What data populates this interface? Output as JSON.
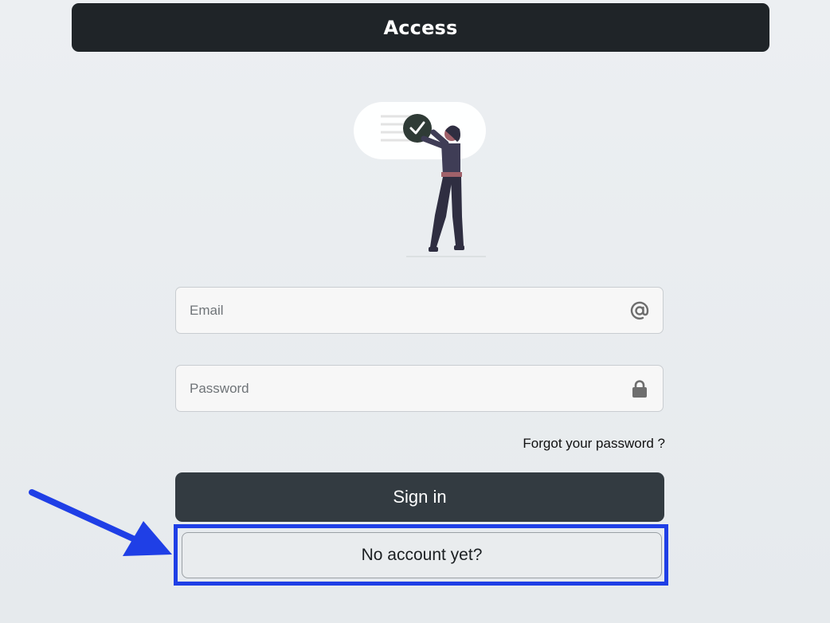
{
  "header": {
    "title": "Access"
  },
  "form": {
    "email_placeholder": "Email",
    "password_placeholder": "Password",
    "forgot_password": "Forgot your password ?",
    "sign_in": "Sign in",
    "no_account": "No account yet?"
  },
  "icons": {
    "email": "at-sign-icon",
    "password": "lock-icon",
    "illustration": "person-with-checkmark-illustration",
    "annotation": "arrow-pointer-annotation"
  },
  "colors": {
    "header_bg": "#1f2428",
    "sign_in_bg": "#333b41",
    "highlight": "#1f3fe6",
    "illustration_check": "#2f3b36",
    "illustration_figure": "#3f3d56",
    "illustration_belt": "#a0616a"
  }
}
